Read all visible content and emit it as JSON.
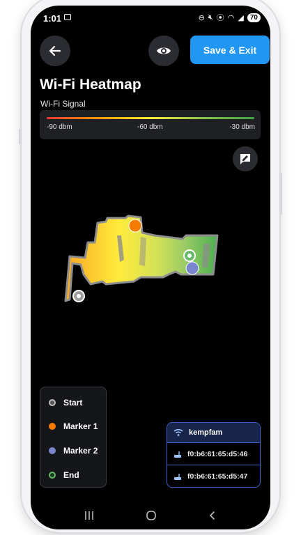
{
  "status_bar": {
    "time": "1:01",
    "battery": "70"
  },
  "header": {
    "save_label": "Save & Exit"
  },
  "title": "Wi-Fi Heatmap",
  "signal": {
    "label": "Wi-Fi Signal",
    "ticks": [
      "-90 dbm",
      "-60 dbm",
      "-30 dbm"
    ],
    "gradient_colors": [
      "#e53935",
      "#ff9800",
      "#ffeb3b",
      "#8bc34a",
      "#43a047"
    ]
  },
  "legend": {
    "items": [
      {
        "label": "Start",
        "color": "#bdbdbd"
      },
      {
        "label": "Marker 1",
        "color": "#f57c00"
      },
      {
        "label": "Marker 2",
        "color": "#7986cb"
      },
      {
        "label": "End",
        "color": "#66bb6a"
      }
    ]
  },
  "network": {
    "ssid": "kempfam",
    "access_points": [
      "f0:b6:61:65:d5:46",
      "f0:b6:61:65:d5:47"
    ]
  },
  "icons": [
    "back-arrow-icon",
    "eye-icon",
    "feedback-icon",
    "wifi-icon",
    "router-icon"
  ]
}
